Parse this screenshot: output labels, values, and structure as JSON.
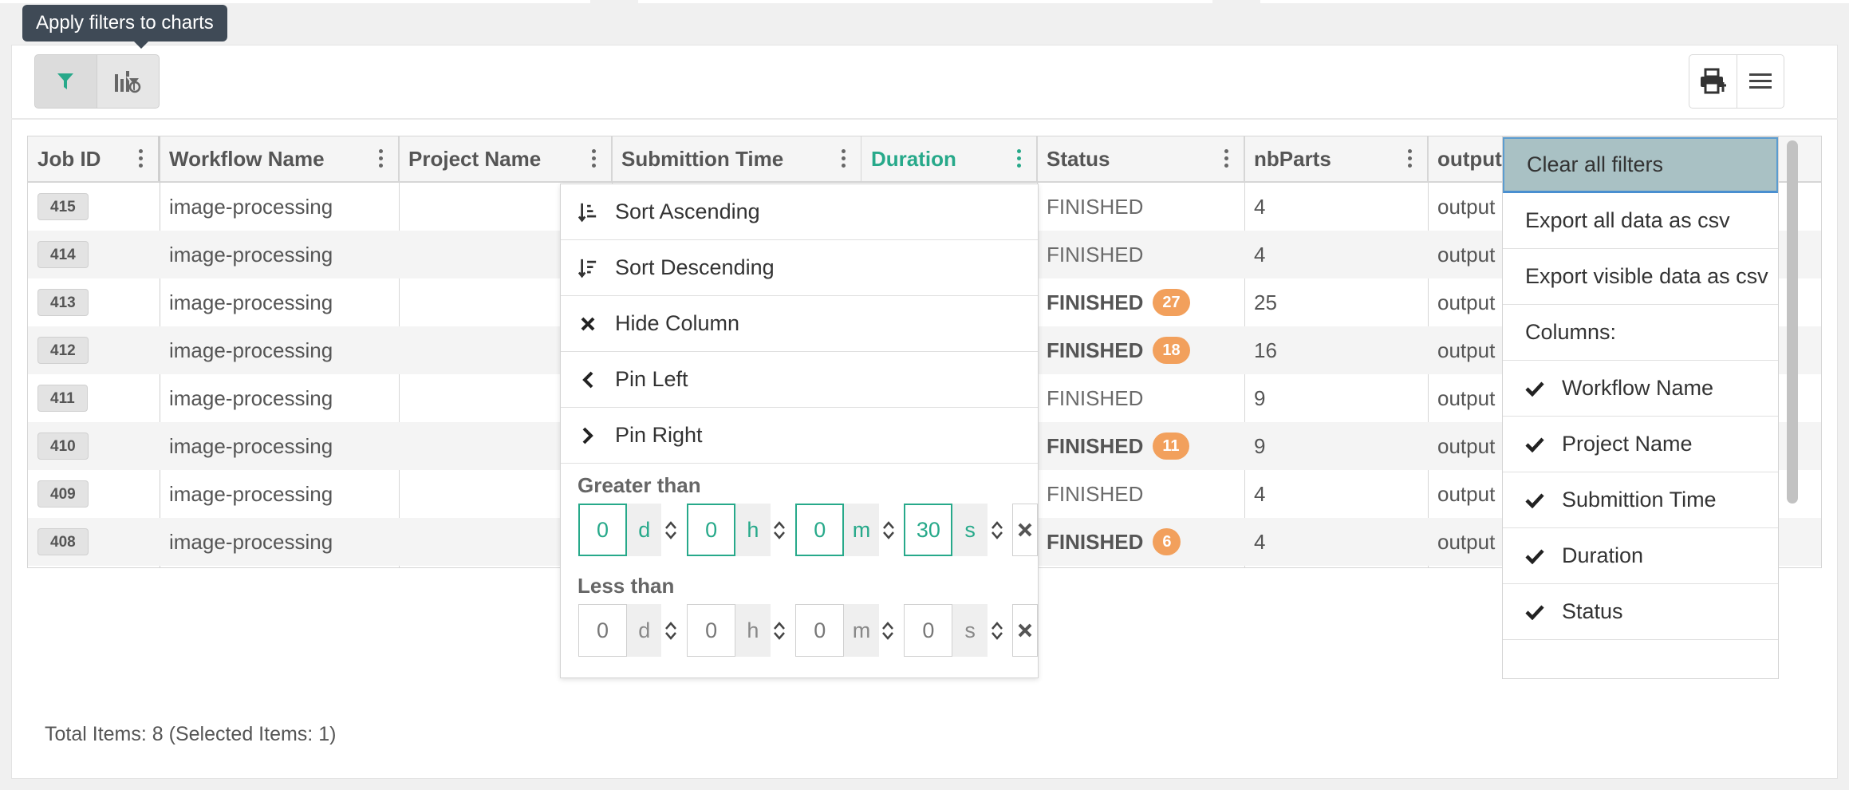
{
  "tooltip": "Apply filters to charts",
  "grid": {
    "columns": [
      "Job ID",
      "Workflow Name",
      "Project Name",
      "Submittion Time",
      "Duration",
      "Status",
      "nbParts",
      "output"
    ],
    "rows": [
      {
        "id": "415",
        "workflow": "image-processing",
        "status": "FINISHED",
        "badge": "",
        "parts": "4",
        "output": "output"
      },
      {
        "id": "414",
        "workflow": "image-processing",
        "status": "FINISHED",
        "badge": "",
        "parts": "4",
        "output": "output"
      },
      {
        "id": "413",
        "workflow": "image-processing",
        "status": "FINISHED",
        "badge": "27",
        "parts": "25",
        "output": "output"
      },
      {
        "id": "412",
        "workflow": "image-processing",
        "status": "FINISHED",
        "badge": "18",
        "parts": "16",
        "output": "output"
      },
      {
        "id": "411",
        "workflow": "image-processing",
        "status": "FINISHED",
        "badge": "",
        "parts": "9",
        "output": "output"
      },
      {
        "id": "410",
        "workflow": "image-processing",
        "status": "FINISHED",
        "badge": "11",
        "parts": "9",
        "output": "output"
      },
      {
        "id": "409",
        "workflow": "image-processing",
        "status": "FINISHED",
        "badge": "",
        "parts": "4",
        "output": "output"
      },
      {
        "id": "408",
        "workflow": "image-processing",
        "status": "FINISHED",
        "badge": "6",
        "parts": "4",
        "output": "output"
      }
    ]
  },
  "column_menu": {
    "items": [
      "Sort Ascending",
      "Sort Descending",
      "Hide Column",
      "Pin Left",
      "Pin Right"
    ],
    "greater_label": "Greater than",
    "less_label": "Less than",
    "greater": {
      "d": "0",
      "h": "0",
      "m": "0",
      "s": "30"
    },
    "less": {
      "d": "0",
      "h": "0",
      "m": "0",
      "s": "0"
    },
    "units": {
      "d": "d",
      "h": "h",
      "m": "m",
      "s": "s"
    }
  },
  "grid_menu": {
    "clear": "Clear all filters",
    "export_all": "Export all data as csv",
    "export_visible": "Export visible data as csv",
    "columns_label": "Columns:",
    "columns": [
      "Workflow Name",
      "Project Name",
      "Submittion Time",
      "Duration",
      "Status"
    ]
  },
  "footer": "Total Items: 8 (Selected Items: 1)",
  "colors": {
    "accent": "#27a98a",
    "badge": "#f2a05c",
    "tooltip": "#3f4a56",
    "highlight": "#a9c1c4"
  },
  "icons": [
    "filter-icon",
    "chart-filter-icon",
    "print-icon",
    "hamburger-menu-icon",
    "sort-ascending-icon",
    "sort-descending-icon",
    "close-icon",
    "chevron-left-icon",
    "chevron-right-icon",
    "check-icon",
    "spinner-up-icon",
    "spinner-down-icon"
  ]
}
